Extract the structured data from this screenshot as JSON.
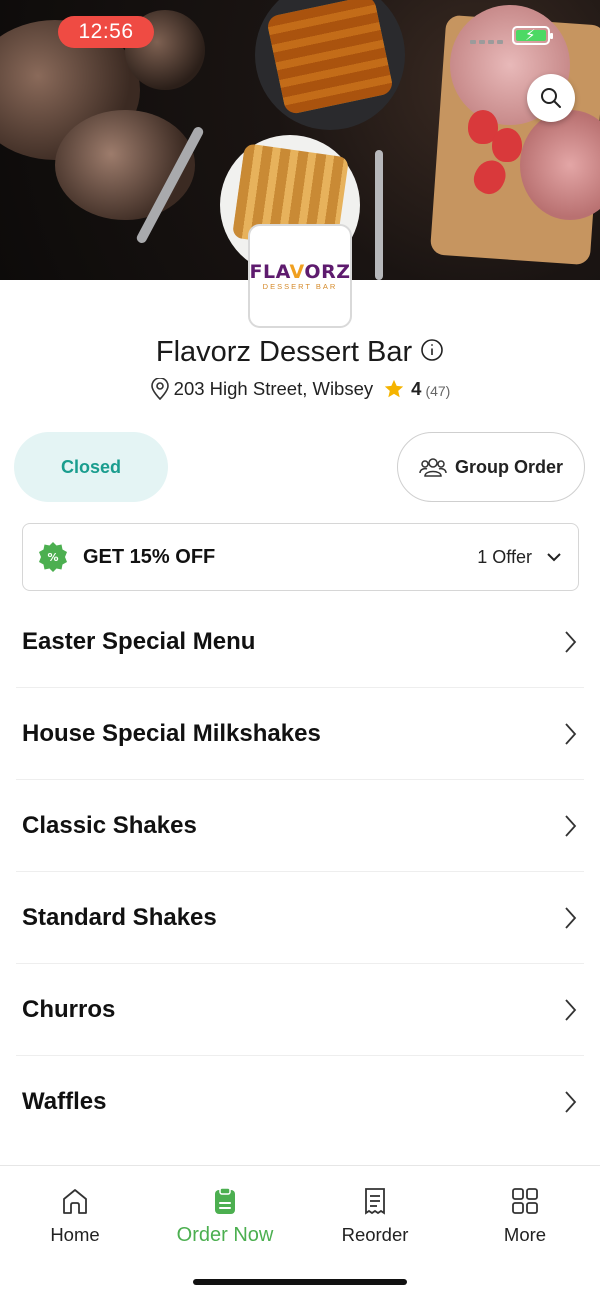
{
  "status_bar": {
    "time": "12:56"
  },
  "store": {
    "logo_main_a": "FLA",
    "logo_main_v": "V",
    "logo_main_b": "ORZ",
    "logo_sub": "DESSERT BAR",
    "name": "Flavorz Dessert Bar",
    "address": "203 High Street, Wibsey",
    "rating": "4",
    "rating_count": "(47)"
  },
  "actions": {
    "status": "Closed",
    "group_order": "Group Order"
  },
  "offer": {
    "title": "GET 15% OFF",
    "count": "1 Offer"
  },
  "menu": [
    {
      "label": "Easter Special Menu"
    },
    {
      "label": "House Special Milkshakes"
    },
    {
      "label": "Classic Shakes"
    },
    {
      "label": "Standard Shakes"
    },
    {
      "label": "Churros"
    },
    {
      "label": "Waffles"
    }
  ],
  "tabs": [
    {
      "label": "Home",
      "icon": "home-icon"
    },
    {
      "label": "Order Now",
      "icon": "order-icon",
      "active": true
    },
    {
      "label": "Reorder",
      "icon": "receipt-icon"
    },
    {
      "label": "More",
      "icon": "grid-icon"
    }
  ],
  "colors": {
    "accent": "#4caf50",
    "closed_text": "#1a9d8e",
    "closed_bg": "#e4f4f4",
    "time_pill": "#ef4b43",
    "star": "#f5b400"
  }
}
